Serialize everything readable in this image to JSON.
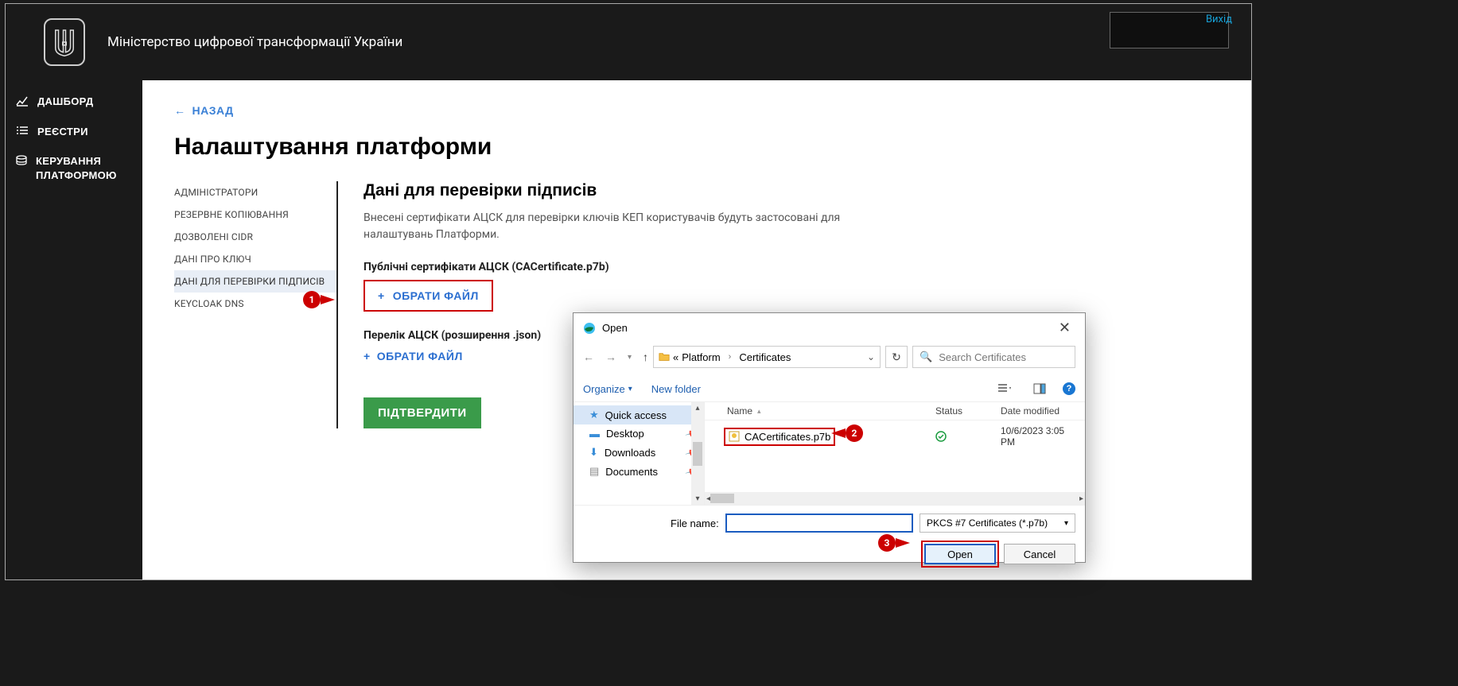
{
  "header": {
    "ministry": "Міністерство цифрової трансформації України",
    "logout": "Вихід"
  },
  "sidebar": {
    "items": [
      {
        "label": "ДАШБОРД"
      },
      {
        "label": "РЕЄСТРИ"
      },
      {
        "label": "КЕРУВАННЯ ПЛАТФОРМОЮ"
      }
    ]
  },
  "main": {
    "back": "НАЗАД",
    "title": "Налаштування платформи",
    "menu": [
      {
        "label": "АДМІНІСТРАТОРИ"
      },
      {
        "label": "РЕЗЕРВНЕ КОПІЮВАННЯ"
      },
      {
        "label": "ДОЗВОЛЕНІ CIDR"
      },
      {
        "label": "ДАНІ ПРО КЛЮЧ"
      },
      {
        "label": "ДАНІ ДЛЯ ПЕРЕВІРКИ ПІДПИСІВ"
      },
      {
        "label": "KEYCLOAK DNS"
      }
    ],
    "section": {
      "heading": "Дані для перевірки підписів",
      "desc": "Внесені сертифікати АЦСК для перевірки ключів КЕП користувачів будуть застосовані для налаштувань Платформи.",
      "pub_cert_label": "Публічні сертифікати АЦСК (CACertificate.p7b)",
      "choose_file": "ОБРАТИ ФАЙЛ",
      "json_label": "Перелік АЦСК (розширення .json)",
      "choose_file2": "ОБРАТИ ФАЙЛ",
      "submit": "ПІДТВЕРДИТИ"
    }
  },
  "callouts": {
    "one": "1",
    "two": "2",
    "three": "3"
  },
  "dialog": {
    "title": "Open",
    "path": {
      "root_marker": "«",
      "seg1": "Platform",
      "seg2": "Certificates"
    },
    "search_placeholder": "Search Certificates",
    "toolbar": {
      "organize": "Organize",
      "new_folder": "New folder"
    },
    "nav": {
      "quick": "Quick access",
      "desktop": "Desktop",
      "downloads": "Downloads",
      "documents": "Documents"
    },
    "headers": {
      "name": "Name",
      "status": "Status",
      "date": "Date modified"
    },
    "file": {
      "name": "CACertificates.p7b",
      "date": "10/6/2023 3:05 PM"
    },
    "file_name_label": "File name:",
    "file_type": "PKCS #7 Certificates (*.p7b)",
    "open": "Open",
    "cancel": "Cancel"
  }
}
